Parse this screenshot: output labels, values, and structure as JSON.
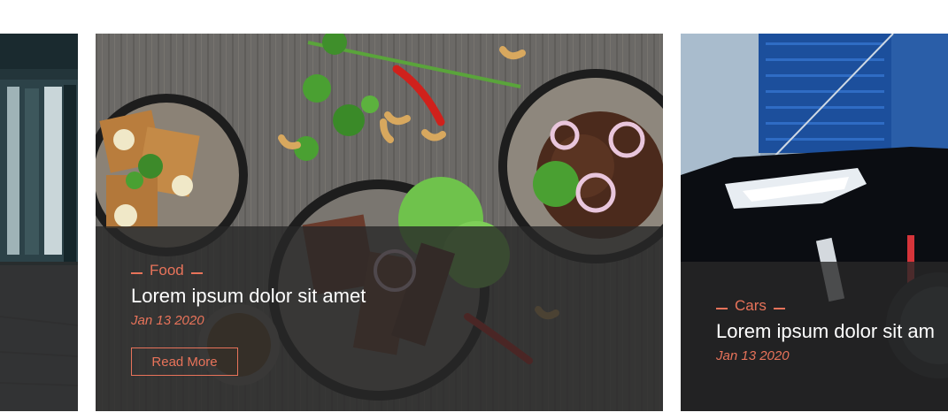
{
  "cards": [
    {},
    {
      "category": "Food",
      "title": "Lorem ipsum dolor sit amet",
      "date": "Jan 13 2020",
      "button": "Read More"
    },
    {
      "category": "Cars",
      "title": "Lorem ipsum dolor sit am",
      "date": "Jan 13 2020"
    }
  ],
  "colors": {
    "accent": "#e8735a",
    "overlay": "#282828",
    "title": "#ffffff"
  }
}
